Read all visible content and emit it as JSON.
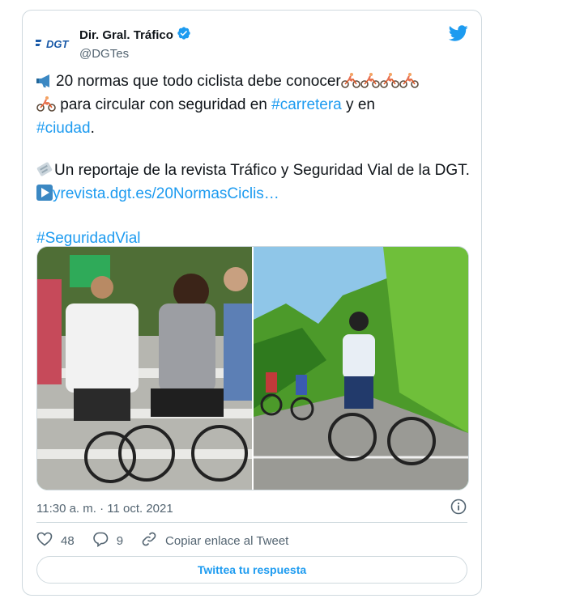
{
  "author": {
    "name": "Dir. Gral. Tráfico",
    "handle": "@DGTes",
    "logo_text": "DGT",
    "verified": true
  },
  "tweet": {
    "line1_text": "20 normas que todo ciclista debe conocer",
    "line2_text": " para circular con seguridad en ",
    "hashtag_carretera": "#carretera",
    "line2_and": " y en",
    "hashtag_ciudad": "#ciudad",
    "period": ".",
    "report_text": "Un reportaje de la revista Tráfico y Seguridad Vial de la DGT. ",
    "report_link": "yrevista.dgt.es/20NormasCiclis…",
    "hashtag_seguridad": "#SeguridadVial"
  },
  "media": {
    "images": [
      "city-cyclists-photo",
      "mountain-road-cyclists-photo"
    ]
  },
  "timestamp": "11:30 a. m. · 11 oct. 2021",
  "actions": {
    "likes": "48",
    "replies": "9",
    "copy_link_label": "Copiar enlace al Tweet"
  },
  "reply_button_label": "Twittea tu respuesta",
  "colors": {
    "accent": "#1d9bf0",
    "text": "#0f1419",
    "muted": "#536471",
    "border": "#cfd9de"
  }
}
